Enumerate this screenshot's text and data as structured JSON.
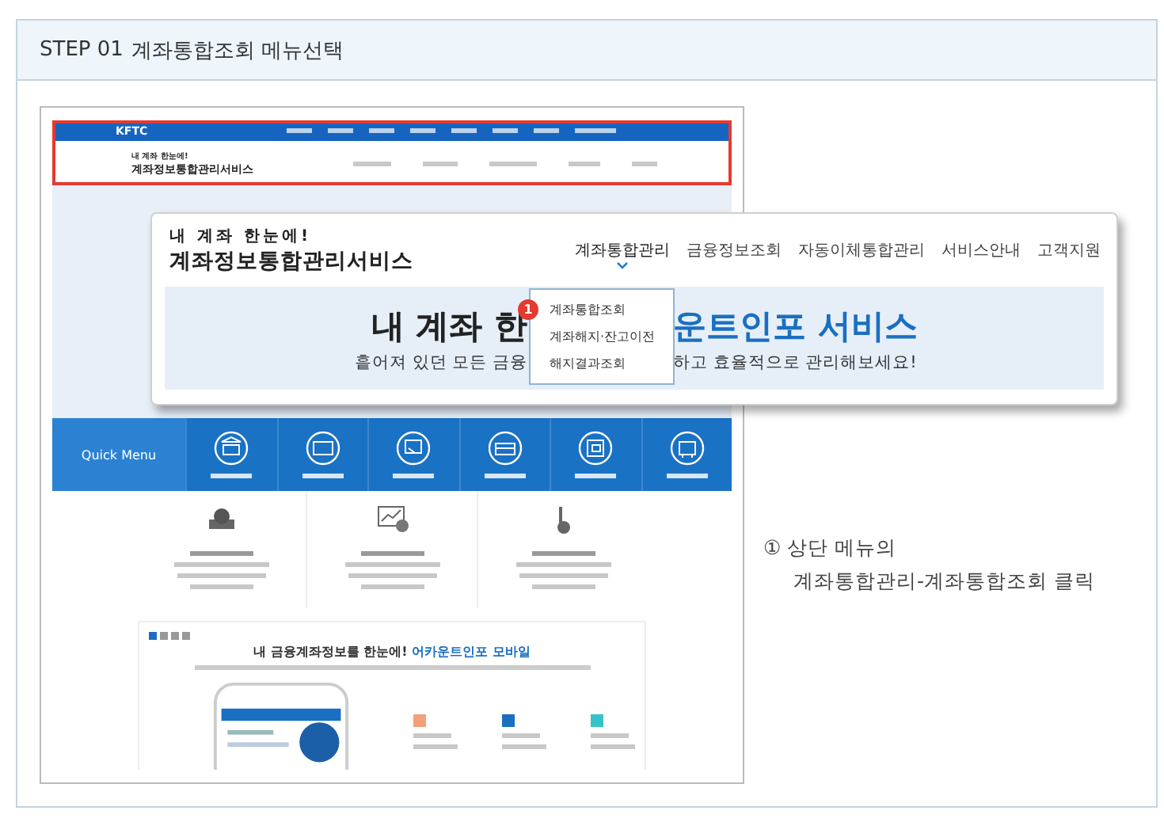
{
  "step_header": {
    "step": "STEP 01",
    "title": "계좌통합조회 메뉴선택"
  },
  "site": {
    "logo": "KFTC",
    "tagline": "내 계좌 한눈에!",
    "service_name": "계좌정보통합관리서비스",
    "highlighted": true,
    "quick_menu": {
      "title": "Quick Menu"
    },
    "mobile": {
      "headline": "내 금융계좌정보를 한눈에!",
      "headline_accent": "어카운트인포 모바일"
    }
  },
  "zoom_popup": {
    "tagline": "내 계좌 한눈에!",
    "service_name": "계좌정보통합관리서비스",
    "nav": [
      {
        "label": "계좌통합관리",
        "selected": true
      },
      {
        "label": "금융정보조회",
        "selected": false
      },
      {
        "label": "자동이체통합관리",
        "selected": false
      },
      {
        "label": "서비스안내",
        "selected": false
      },
      {
        "label": "고객지원",
        "selected": false
      }
    ],
    "dropdown": [
      {
        "label": "계좌통합조회",
        "badge": "1"
      },
      {
        "label": "계좌해지·잔고이전"
      },
      {
        "label": "해지결과조회"
      }
    ],
    "hero": {
      "title_left": "내 계좌 한",
      "title_right": "운트인포 서비스",
      "subtitle_left": "흩어져 있던 모든 금융",
      "subtitle_right": "하고 효율적으로 관리해보세요!"
    }
  },
  "caption": {
    "lines": [
      "① 상단 메뉴의",
      "계좌통합관리-계좌통합조회 클릭"
    ]
  }
}
